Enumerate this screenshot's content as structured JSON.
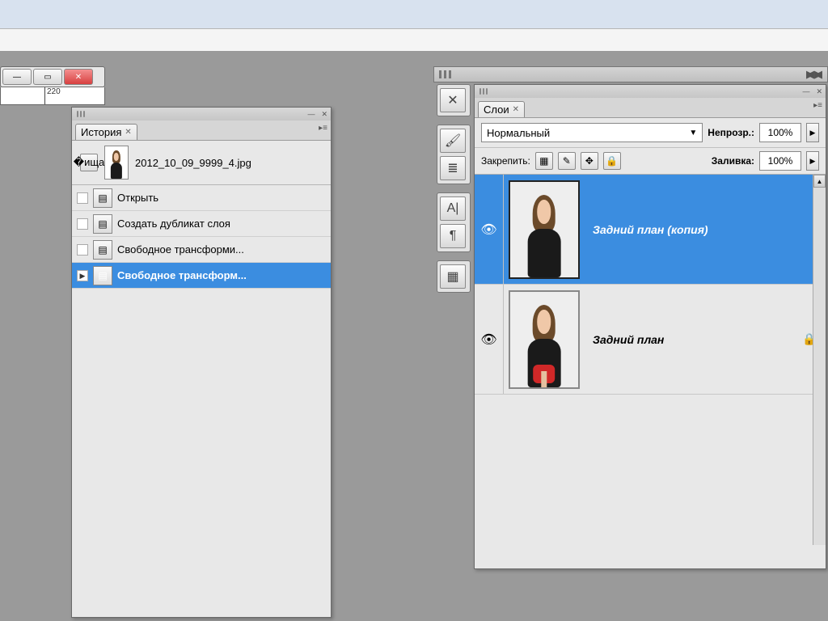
{
  "ruler": {
    "tick1": "220"
  },
  "history": {
    "tab": "История",
    "filename": "2012_10_09_9999_4.jpg",
    "steps": [
      {
        "label": "Открыть",
        "selected": false,
        "current": false
      },
      {
        "label": "Создать дубликат слоя",
        "selected": false,
        "current": false
      },
      {
        "label": "Свободное трансформи...",
        "selected": false,
        "current": false
      },
      {
        "label": "Свободное трансформ...",
        "selected": true,
        "current": true
      }
    ]
  },
  "layers": {
    "tab": "Слои",
    "blend_mode": "Нормальный",
    "opacity_label": "Непрозр.:",
    "opacity_value": "100%",
    "lock_label": "Закрепить:",
    "fill_label": "Заливка:",
    "fill_value": "100%",
    "items": [
      {
        "name": "Задний план (копия)",
        "selected": true,
        "visible": true,
        "locked": false
      },
      {
        "name": "Задний план",
        "selected": false,
        "visible": true,
        "locked": true
      }
    ]
  }
}
